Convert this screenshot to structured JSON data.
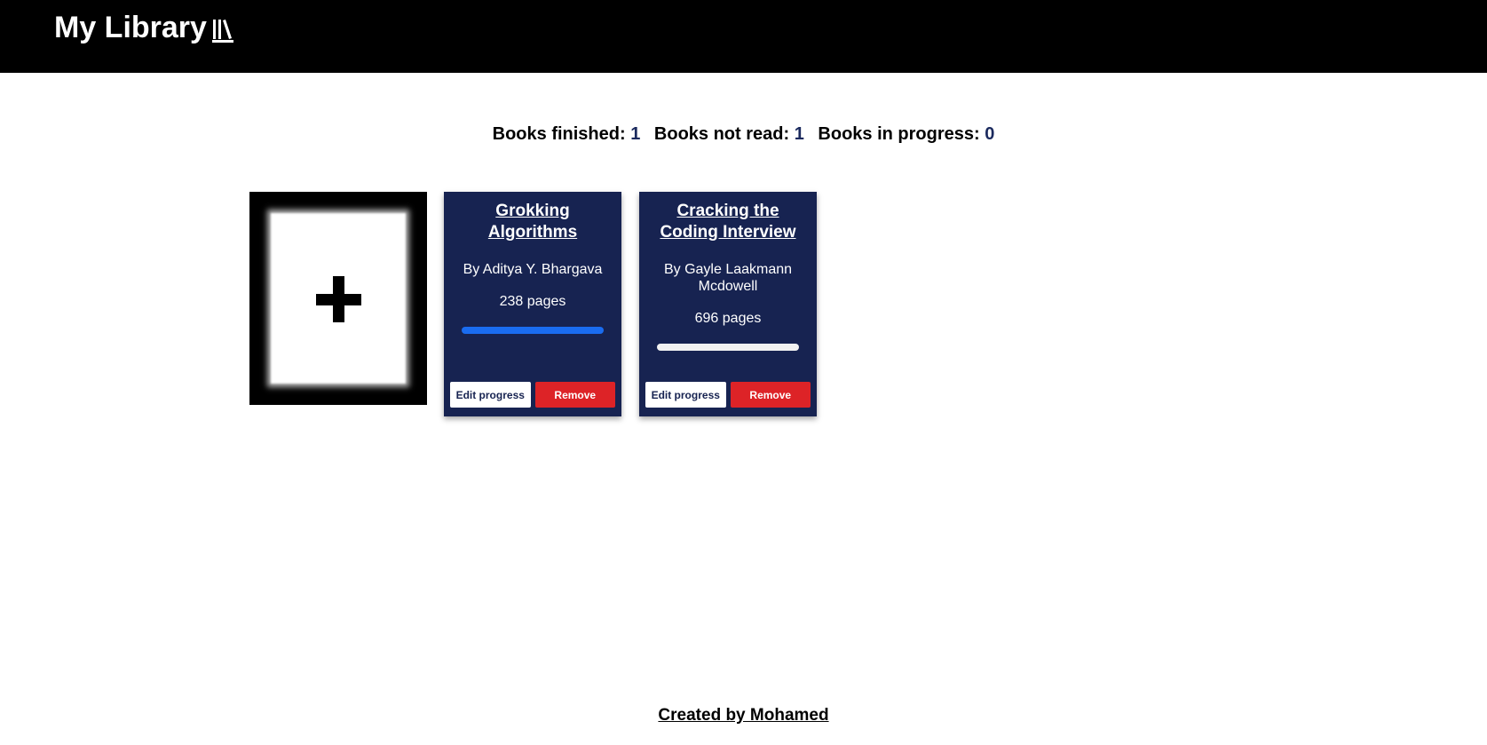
{
  "header": {
    "title": "My Library",
    "icon": "library-books-icon",
    "background": "#000000"
  },
  "stats": {
    "finished_label": "Books finished:",
    "finished_count": "1",
    "not_read_label": "Books not read:",
    "not_read_count": "1",
    "in_progress_label": "Books in progress:",
    "in_progress_count": "0"
  },
  "add_card": {
    "icon": "plus-icon"
  },
  "books": [
    {
      "title": "Grokking Algorithms",
      "author": "By Aditya Y. Bhargava",
      "pages": "238 pages",
      "progress_percent": 100,
      "edit_label": "Edit progress",
      "remove_label": "Remove"
    },
    {
      "title": "Cracking the Coding Interview",
      "author": "By Gayle Laakmann Mcdowell",
      "pages": "696 pages",
      "progress_percent": 0,
      "edit_label": "Edit progress",
      "remove_label": "Remove"
    }
  ],
  "footer": {
    "credit": "Created by Mohamed"
  },
  "colors": {
    "card_background": "#172351",
    "progress_fill": "#1a6cf0",
    "remove_button": "#dd2327",
    "stat_number": "#1b2a5e"
  }
}
